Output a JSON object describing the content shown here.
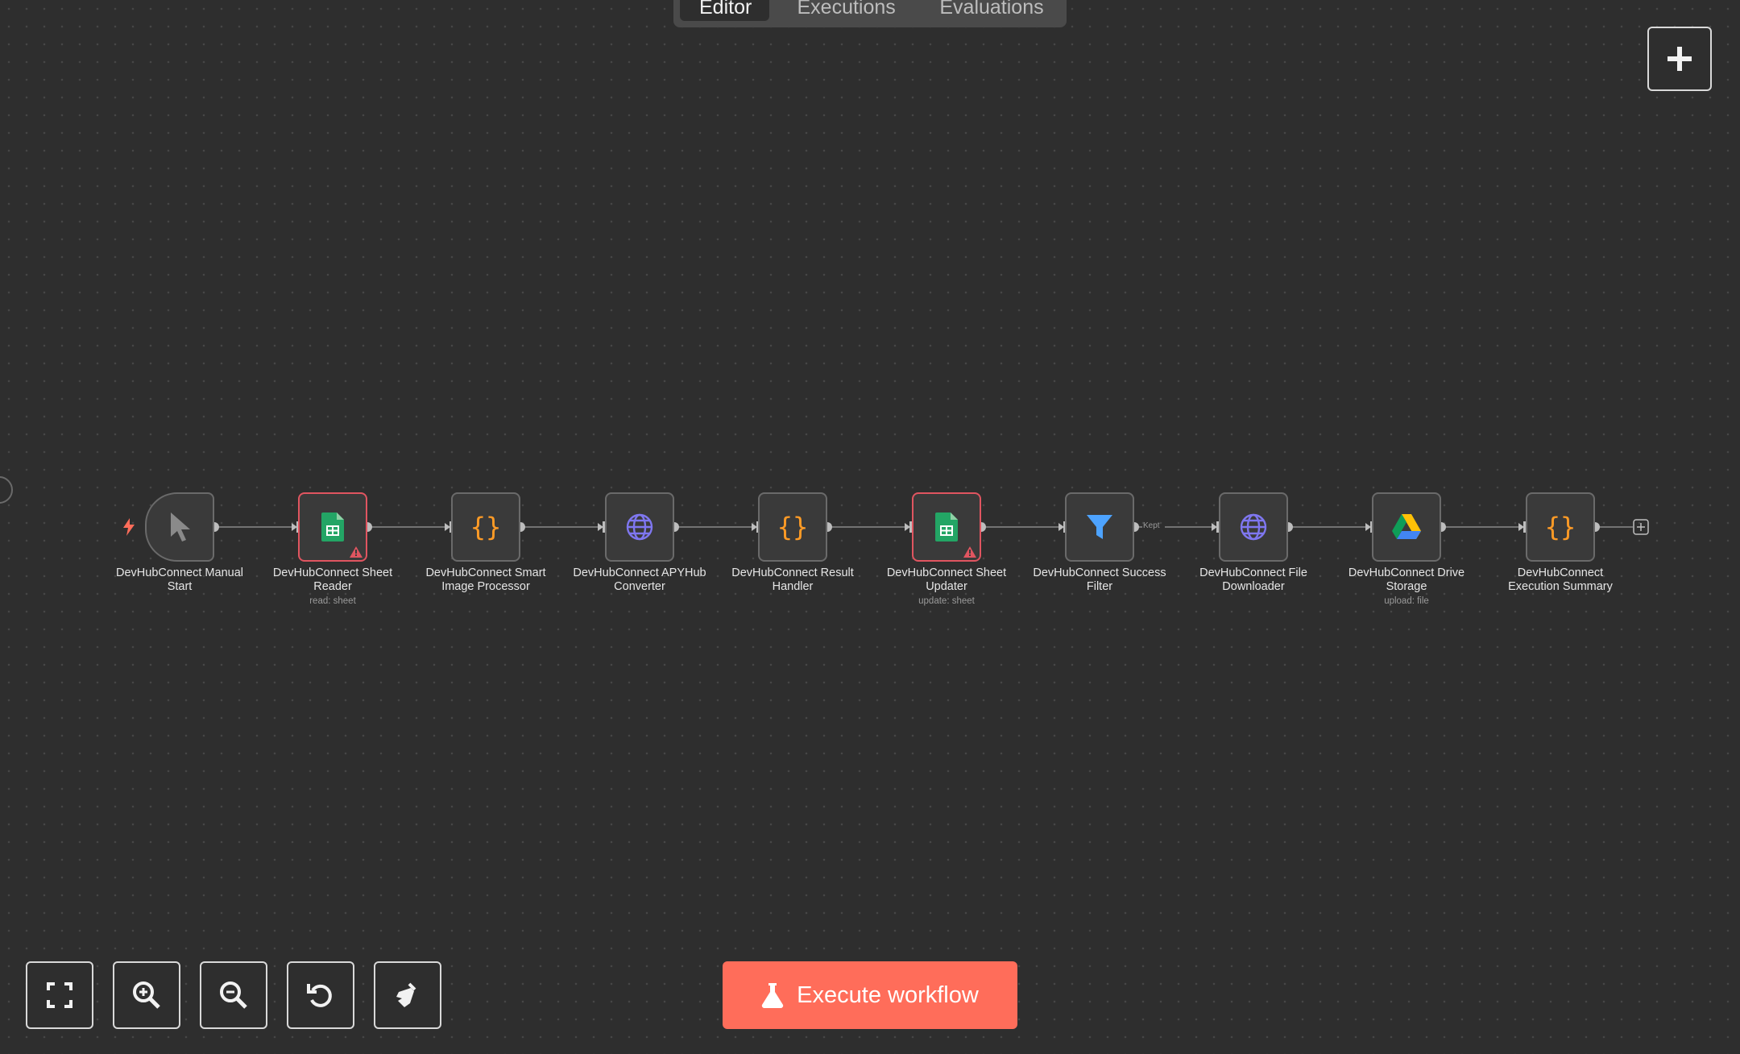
{
  "tabs": [
    {
      "label": "Editor",
      "active": true
    },
    {
      "label": "Executions",
      "active": false
    },
    {
      "label": "Evaluations",
      "active": false
    }
  ],
  "colors": {
    "canvas_bg": "#2e2e2e",
    "node_bg": "#3a3a3a",
    "node_border": "#6a6a6a",
    "error_border": "#e05560",
    "execute_button": "#ff6d5a",
    "code_icon": "#ff9b26",
    "http_icon": "#7f77f0",
    "filter_icon": "#4da3ff",
    "sheets_icon": "#23a565"
  },
  "nodes": [
    {
      "name": "DevHubConnect Manual Start",
      "line1": "DevHubConnect Manual",
      "line2": "Start",
      "subtitle": "",
      "icon": "cursor-icon",
      "error": false
    },
    {
      "name": "DevHubConnect Sheet Reader",
      "line1": "DevHubConnect Sheet",
      "line2": "Reader",
      "subtitle": "read: sheet",
      "icon": "google-sheets-icon",
      "error": true
    },
    {
      "name": "DevHubConnect Smart Image Processor",
      "line1": "DevHubConnect Smart",
      "line2": "Image Processor",
      "subtitle": "",
      "icon": "code-braces-icon",
      "error": false
    },
    {
      "name": "DevHubConnect APYHub Converter",
      "line1": "DevHubConnect APYHub",
      "line2": "Converter",
      "subtitle": "",
      "icon": "globe-icon",
      "error": false
    },
    {
      "name": "DevHubConnect Result Handler",
      "line1": "DevHubConnect Result",
      "line2": "Handler",
      "subtitle": "",
      "icon": "code-braces-icon",
      "error": false
    },
    {
      "name": "DevHubConnect Sheet Updater",
      "line1": "DevHubConnect Sheet",
      "line2": "Updater",
      "subtitle": "update: sheet",
      "icon": "google-sheets-icon",
      "error": true
    },
    {
      "name": "DevHubConnect Success Filter",
      "line1": "DevHubConnect Success",
      "line2": "Filter",
      "subtitle": "",
      "icon": "filter-icon",
      "error": false
    },
    {
      "name": "DevHubConnect File Downloader",
      "line1": "DevHubConnect File",
      "line2": "Downloader",
      "subtitle": "",
      "icon": "globe-icon",
      "error": false
    },
    {
      "name": "DevHubConnect Drive Storage",
      "line1": "DevHubConnect Drive",
      "line2": "Storage",
      "subtitle": "upload: file",
      "icon": "google-drive-icon",
      "error": false
    },
    {
      "name": "DevHubConnect Execution Summary",
      "line1": "DevHubConnect",
      "line2": "Execution Summary",
      "subtitle": "",
      "icon": "code-braces-icon",
      "error": false
    }
  ],
  "edge_labels": {
    "filter_output": "Kept"
  },
  "controls": [
    {
      "name": "zoom-to-fit-button",
      "icon": "fullscreen-icon"
    },
    {
      "name": "zoom-in-button",
      "icon": "zoom-in-icon"
    },
    {
      "name": "zoom-out-button",
      "icon": "zoom-out-icon"
    },
    {
      "name": "reset-zoom-button",
      "icon": "reset-icon"
    },
    {
      "name": "tidy-up-button",
      "icon": "broom-icon"
    }
  ],
  "execute_button": {
    "label": "Execute workflow",
    "icon": "flask-icon"
  },
  "top_right_button": {
    "icon": "plus-icon"
  }
}
